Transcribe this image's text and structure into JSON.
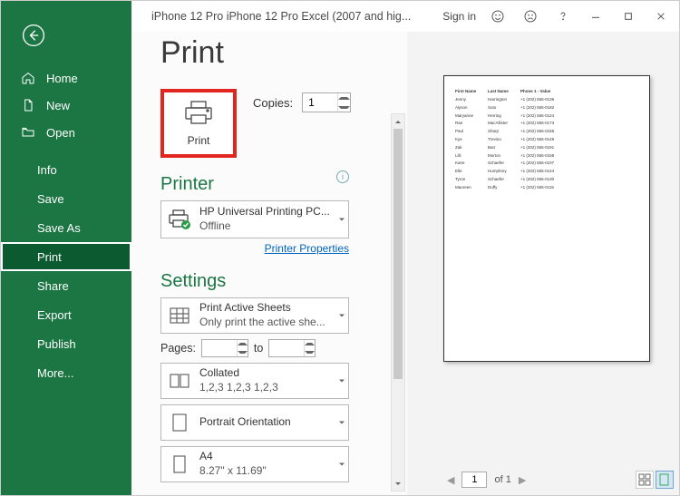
{
  "titlebar": {
    "title": "iPhone 12 Pro iPhone 12 Pro Excel (2007 and hig...",
    "signin": "Sign in"
  },
  "sidebar": {
    "home": "Home",
    "new": "New",
    "open": "Open",
    "info": "Info",
    "save": "Save",
    "saveas": "Save As",
    "print": "Print",
    "share": "Share",
    "export": "Export",
    "publish": "Publish",
    "more": "More..."
  },
  "print": {
    "heading": "Print",
    "button_label": "Print",
    "copies_label": "Copies:",
    "copies_value": "1"
  },
  "printer": {
    "heading": "Printer",
    "name": "HP Universal Printing PC...",
    "status": "Offline",
    "properties_link": "Printer Properties"
  },
  "settings": {
    "heading": "Settings",
    "active_title": "Print Active Sheets",
    "active_sub": "Only print the active she...",
    "pages_label": "Pages:",
    "pages_to": "to",
    "collated_title": "Collated",
    "collated_sub": "1,2,3    1,2,3    1,2,3",
    "orient_title": "Portrait Orientation",
    "paper_title": "A4",
    "paper_sub": "8.27\" x 11.69\""
  },
  "preview": {
    "page_current": "1",
    "page_of": "of 1",
    "header": {
      "c1": "First Name",
      "c2": "Last Name",
      "c3": "Phone 1 - Value"
    },
    "rows": [
      {
        "c1": "Jenny",
        "c2": "Harrington",
        "c3": "+1 (202) 555-0136"
      },
      {
        "c1": "Alyson",
        "c2": "Soto",
        "c3": "+1 (202) 555-0182"
      },
      {
        "c1": "Maryanne",
        "c2": "Herring",
        "c3": "+1 (202) 555-0124"
      },
      {
        "c1": "Rae",
        "c2": "MacAllister",
        "c3": "+1 (202) 555-0173"
      },
      {
        "c1": "Paul",
        "c2": "Sharp",
        "c3": "+1 (202) 555-0165"
      },
      {
        "c1": "Kye",
        "c2": "Trevino",
        "c3": "+1 (202) 555-0149"
      },
      {
        "c1": "Zak",
        "c2": "Barr",
        "c3": "+1 (202) 555-0191"
      },
      {
        "c1": "Lilli",
        "c2": "Morton",
        "c3": "+1 (202) 555-0158"
      },
      {
        "c1": "Kane",
        "c2": "Schaefer",
        "c3": "+1 (202) 555-0107"
      },
      {
        "c1": "Elle",
        "c2": "Humphrey",
        "c3": "+1 (202) 555-0144"
      },
      {
        "c1": "Tyron",
        "c2": "Schaefer",
        "c3": "+1 (202) 555-0130"
      },
      {
        "c1": "Maureen",
        "c2": "Duffy",
        "c3": "+1 (202) 555-0115"
      }
    ]
  }
}
